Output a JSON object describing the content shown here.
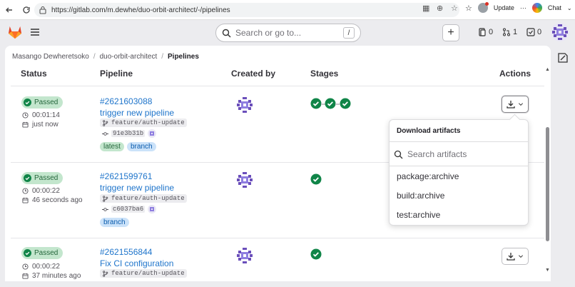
{
  "browser": {
    "url": "https://gitlab.com/m.dewhe/duo-orbit-architect/-/pipelines",
    "update_label": "Update",
    "more_label": "···",
    "chat_label": "Chat"
  },
  "header": {
    "search_placeholder": "Search or go to...",
    "search_shortcut": "/",
    "issues_count": "0",
    "mr_count": "1",
    "todo_count": "0"
  },
  "breadcrumb": {
    "owner": "Masango Dewheretsoko",
    "project": "duo-orbit-architect",
    "page": "Pipelines",
    "separator": "/"
  },
  "table": {
    "headers": {
      "status": "Status",
      "pipeline": "Pipeline",
      "created_by": "Created by",
      "stages": "Stages",
      "actions": "Actions"
    },
    "rows": [
      {
        "status": "Passed",
        "duration": "00:01:14",
        "finished": "just now",
        "id": "#2621603088",
        "name": "trigger new pipeline",
        "branch": "feature/auth-update",
        "commit": "91e3b31b",
        "tags": [
          "latest",
          "branch"
        ]
      },
      {
        "status": "Passed",
        "duration": "00:00:22",
        "finished": "46 seconds ago",
        "id": "#2621599761",
        "name": "trigger new pipeline",
        "branch": "feature/auth-update",
        "commit": "c6037ba6",
        "tags": [
          "branch"
        ]
      },
      {
        "status": "Passed",
        "duration": "00:00:22",
        "finished": "37 minutes ago",
        "id": "#2621556844",
        "name": "Fix CI configuration",
        "branch": "feature/auth-update"
      }
    ]
  },
  "artifacts_dropdown": {
    "title": "Download artifacts",
    "search_placeholder": "Search artifacts",
    "items": [
      "package:archive",
      "build:archive",
      "test:archive"
    ]
  },
  "colors": {
    "passed": "#108548",
    "link": "#1f75cb",
    "page_bg": "#ececef"
  }
}
